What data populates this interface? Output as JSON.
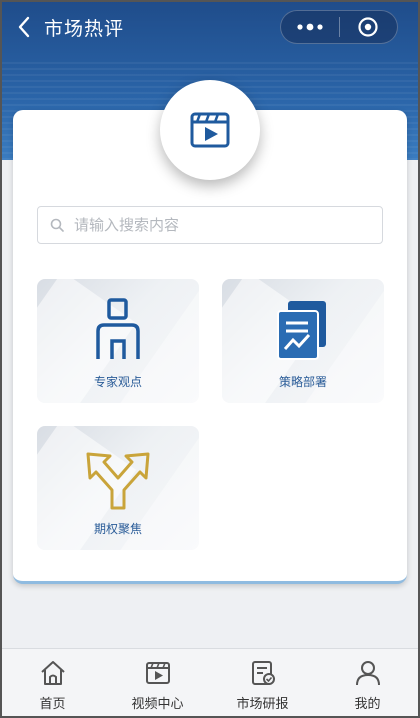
{
  "nav": {
    "title": "市场热评"
  },
  "search": {
    "placeholder": "请输入搜索内容"
  },
  "tiles": [
    {
      "label": "专家观点",
      "icon": "expert-person-icon"
    },
    {
      "label": "策略部署",
      "icon": "strategy-doc-icon"
    },
    {
      "label": "期权聚焦",
      "icon": "options-arrows-icon"
    }
  ],
  "tabs": [
    {
      "label": "首页",
      "icon": "home-icon"
    },
    {
      "label": "视频中心",
      "icon": "video-icon"
    },
    {
      "label": "市场研报",
      "icon": "report-icon"
    },
    {
      "label": "我的",
      "icon": "user-icon"
    }
  ],
  "colors": {
    "header": "#1f4c8a",
    "accent": "#2a64a8",
    "gold": "#c9a43a"
  }
}
